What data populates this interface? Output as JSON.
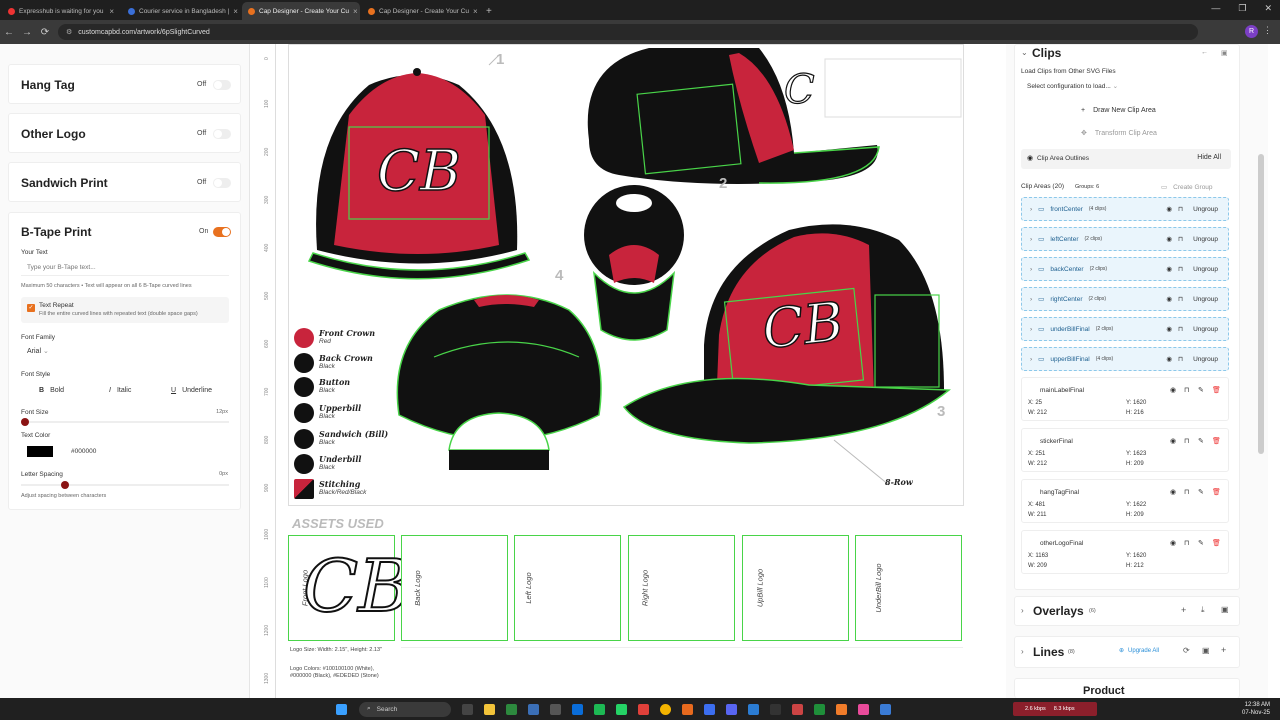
{
  "browser": {
    "tabs": [
      {
        "label": "Expresshub is waiting for you",
        "color": "#e33"
      },
      {
        "label": "Courier service in Bangladesh |",
        "color": "#3a6fd8"
      },
      {
        "label": "Cap Designer - Create Your Cu",
        "color": "#e8711f",
        "active": true
      },
      {
        "label": "Cap Designer - Create Your Cu",
        "color": "#e8711f"
      }
    ],
    "url": "customcapbd.com/artwork/6pSlightCurved",
    "avatar": "R"
  },
  "left": {
    "hang_tag": {
      "title": "Hang Tag",
      "state": "Off"
    },
    "other_logo": {
      "title": "Other Logo",
      "state": "Off"
    },
    "sandwich": {
      "title": "Sandwich Print",
      "state": "Off"
    },
    "btape": {
      "title": "B-Tape Print",
      "state": "On",
      "your_text_label": "Your Text",
      "your_text_placeholder": "Type your B-Tape text...",
      "hint": "Maximum 50 characters • Text will appear on all 6 B-Tape curved lines",
      "repeat_title": "Text Repeat",
      "repeat_desc": "Fill the entire curved lines with repeated text (double space gaps)",
      "font_family_label": "Font Family",
      "font_family_value": "Arial",
      "font_style_label": "Font Style",
      "bold": "Bold",
      "italic": "Italic",
      "underline": "Underline",
      "font_size_label": "Font Size",
      "font_size_value": "12px",
      "font_size_level": 0.0,
      "text_color_label": "Text Color",
      "text_color_value": "#000000",
      "letter_spacing_label": "Letter Spacing",
      "letter_spacing_value": "0px",
      "letter_spacing_level": 0.2,
      "letter_spacing_hint": "Adjust spacing between characters"
    }
  },
  "canvas": {
    "views": [
      "1",
      "2",
      "4",
      "3"
    ],
    "row_label": "8-Row",
    "legend": [
      {
        "name": "Front Crown",
        "color_name": "Red",
        "hex": "#c8243c"
      },
      {
        "name": "Back Crown",
        "color_name": "Black",
        "hex": "#111111"
      },
      {
        "name": "Button",
        "color_name": "Black",
        "hex": "#111111"
      },
      {
        "name": "Upperbill",
        "color_name": "Black",
        "hex": "#111111"
      },
      {
        "name": "Sandwich (Bill)",
        "color_name": "Black",
        "hex": "#111111"
      },
      {
        "name": "Underbill",
        "color_name": "Black",
        "hex": "#111111"
      },
      {
        "name": "Stitching",
        "color_name": "Black/Red/Black",
        "hex": "#c8243c"
      }
    ],
    "ruler_ticks": [
      "0",
      "100",
      "200",
      "300",
      "400",
      "500",
      "600",
      "700",
      "800",
      "900",
      "1000",
      "1100",
      "1200",
      "1300"
    ]
  },
  "assets": {
    "title": "ASSETS USED",
    "items": [
      "Front Logo",
      "Back Logo",
      "Left Logo",
      "Right Logo",
      "UpBill Logo",
      "UnderBill Logo"
    ],
    "logo_size": "Logo Size: Width: 2.15\", Height: 2.13\"",
    "logo_colors": "Logo Colors: #100100100 (White), #000000 (Black), #EDEDED (Stone)"
  },
  "right": {
    "clips_title": "Clips",
    "load_label": "Load Clips from Other SVG Files",
    "select_placeholder": "Select configuration to load...",
    "draw_new": "Draw New Clip Area",
    "transform": "Transform Clip Area",
    "outlines": "Clip Area Outlines",
    "hide_all": "Hide All",
    "clip_areas": "Clip Areas (20)",
    "groups": "Groups: 6",
    "create_group": "Create Group",
    "ungroup": "Ungroup",
    "clip_groups": [
      {
        "name": "frontCenter",
        "count": "(4 clips)"
      },
      {
        "name": "leftCenter",
        "count": "(2 clips)"
      },
      {
        "name": "backCenter",
        "count": "(2 clips)"
      },
      {
        "name": "rightCenter",
        "count": "(2 clips)"
      },
      {
        "name": "underBillFinal",
        "count": "(2 clips)"
      },
      {
        "name": "upperBillFinal",
        "count": "(4 clips)"
      }
    ],
    "clips": [
      {
        "name": "mainLabelFinal",
        "x": "X: 25",
        "y": "Y: 1620",
        "w": "W: 212",
        "h": "H: 216"
      },
      {
        "name": "stickerFinal",
        "x": "X: 251",
        "y": "Y: 1623",
        "w": "W: 212",
        "h": "H: 209"
      },
      {
        "name": "hangTagFinal",
        "x": "X: 481",
        "y": "Y: 1622",
        "w": "W: 211",
        "h": "H: 209"
      },
      {
        "name": "otherLogoFinal",
        "x": "X: 1163",
        "y": "Y: 1620",
        "w": "W: 209",
        "h": "H: 212"
      }
    ],
    "overlays": "Overlays",
    "overlays_count": "(6)",
    "lines": "Lines",
    "lines_count": "(8)",
    "upgrade": "Upgrade All",
    "product": "Product"
  },
  "taskbar": {
    "search": "Search",
    "net_down": "2.6 kbps",
    "net_up": "8.3 kbps",
    "time": "12:38 AM",
    "date": "07-Nov-25"
  },
  "colors": {
    "accent": "#e8711f",
    "clip_border": "#8cc8ea",
    "stitch": "#49d449",
    "crown_red": "#c8243c"
  }
}
